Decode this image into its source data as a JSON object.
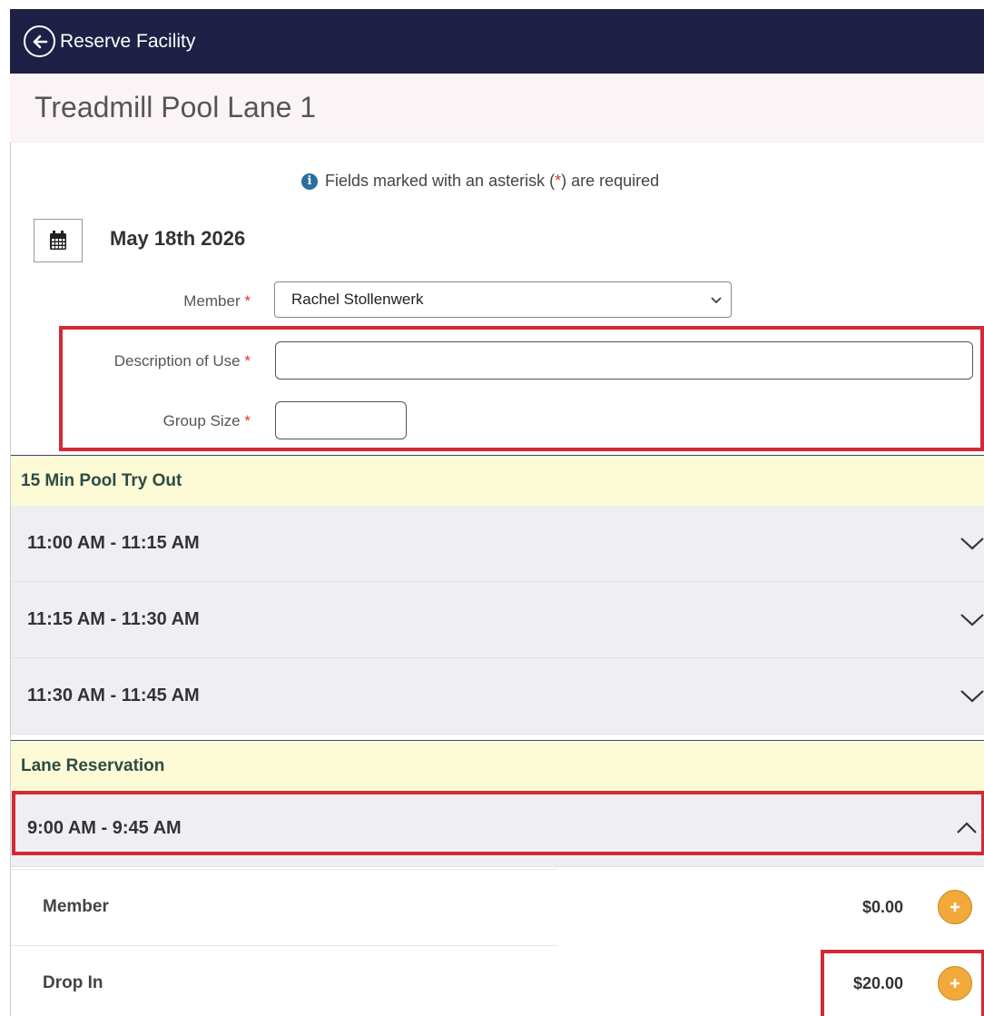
{
  "topbar": {
    "title": "Reserve Facility"
  },
  "page": {
    "title": "Treadmill Pool Lane 1"
  },
  "notice": {
    "prefix": "Fields marked with an asterisk (",
    "asterisk": "*",
    "suffix": ") are required"
  },
  "date": {
    "label": "May 18th 2026"
  },
  "form": {
    "member_label": "Member",
    "member_value": "Rachel Stollenwerk",
    "description_label": "Description of Use",
    "description_value": "",
    "group_size_label": "Group Size",
    "group_size_value": "",
    "required_mark": "*"
  },
  "sections": [
    {
      "title": "15 Min Pool Try Out",
      "slots": [
        "11:00 AM - 11:15 AM",
        "11:15 AM - 11:30 AM",
        "11:30 AM - 11:45 AM"
      ]
    },
    {
      "title": "Lane Reservation",
      "slots": [
        "9:00 AM - 9:45 AM"
      ]
    }
  ],
  "rates": [
    {
      "name": "Member",
      "price": "$0.00"
    },
    {
      "name": "Drop In",
      "price": "$20.00"
    }
  ],
  "colors": {
    "topbar_bg": "#1e2145",
    "section_bg": "#fcfbd6",
    "slot_bg": "#efeef3",
    "highlight": "#d42a35",
    "add_button": "#f1a93a",
    "required": "#dd3333"
  }
}
